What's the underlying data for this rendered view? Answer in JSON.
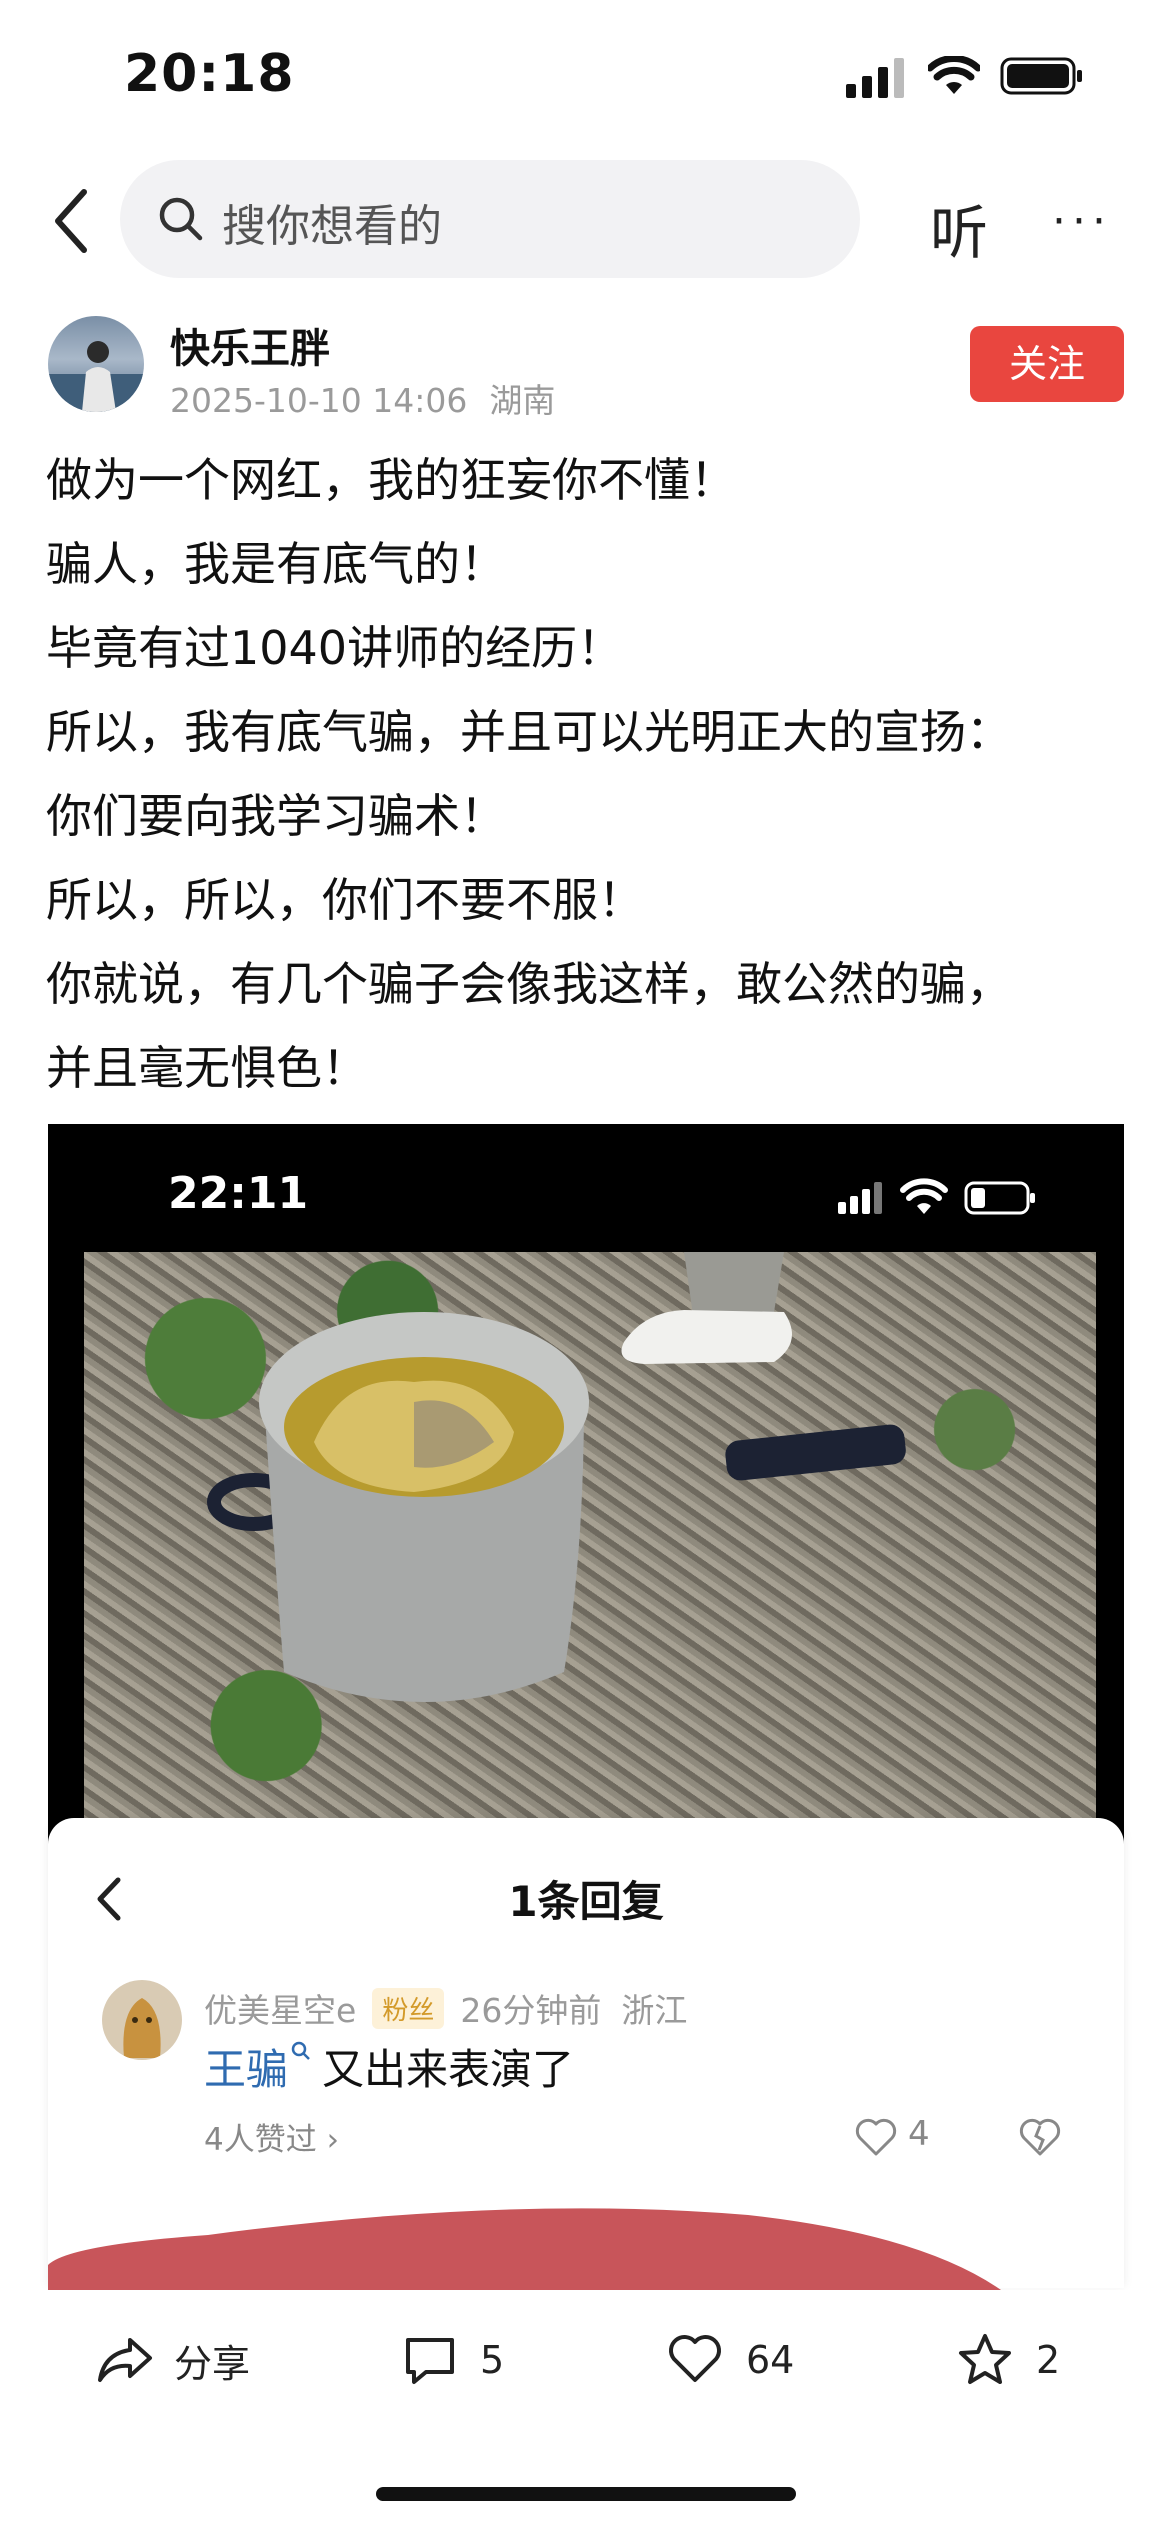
{
  "status_bar": {
    "time": "20:18"
  },
  "top_bar": {
    "search_placeholder": "搜你想看的",
    "listen_label": "听",
    "more_label": "···"
  },
  "post": {
    "author": "快乐王胖",
    "date": "2025-10-10 14:06",
    "location": "湖南",
    "follow_label": "关注",
    "lines": [
      "做为一个网红，我的狂妄你不懂！",
      "骗人，我是有底气的！",
      "毕竟有过1040讲师的经历！",
      "所以，我有底气骗，并且可以光明正大的宣扬：",
      "你们要向我学习骗术！",
      "所以，所以，你们不要不服！",
      "你就说，有几个骗子会像我这样，敢公然的骗，",
      "并且毫无惧色！"
    ]
  },
  "embedded_screenshot": {
    "time": "22:11"
  },
  "reply_panel": {
    "title": "1条回复",
    "comment": {
      "user": "优美星空e",
      "badge": "粉丝",
      "time": "26分钟前",
      "location": "浙江",
      "mention": "王骗",
      "text": "又出来表演了",
      "likes_text": "4人赞过 ›",
      "like_count": "4"
    }
  },
  "bottom_bar": {
    "share_label": "分享",
    "comment_count": "5",
    "like_count": "64",
    "fav_count": "2"
  }
}
